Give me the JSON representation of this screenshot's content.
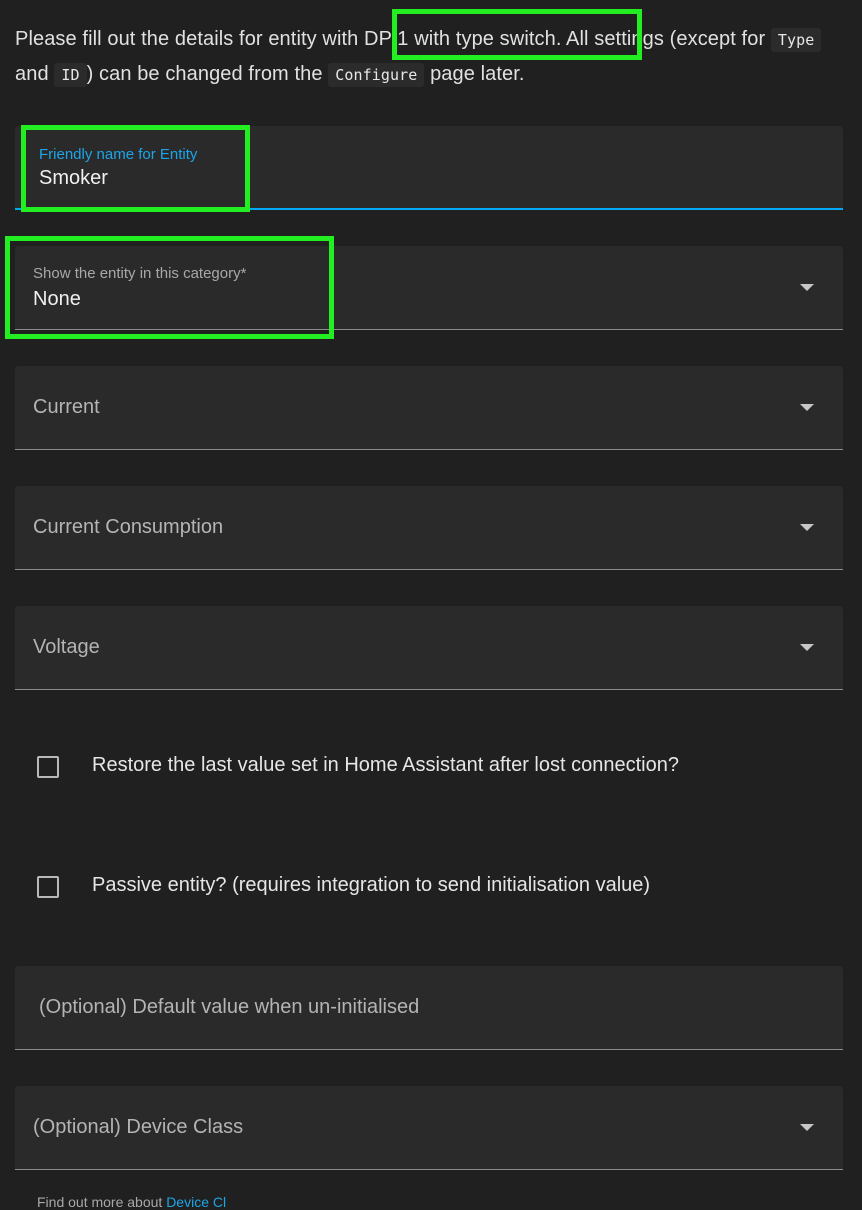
{
  "intro": {
    "part1": "Please fill out the details for entity with ",
    "dp_highlight": "DP 1 with type switch.",
    "part2": " All settings (except for ",
    "code_type": "Type",
    "part3": " and ",
    "code_id": "ID",
    "part4": ") can be changed from the ",
    "code_configure": "Configure",
    "part5": " page later."
  },
  "fields": {
    "friendly_name": {
      "label": "Friendly name for Entity",
      "value": "Smoker"
    },
    "category": {
      "label": "Show the entity in this category*",
      "value": "None"
    },
    "current": {
      "placeholder": "Current"
    },
    "current_consumption": {
      "placeholder": "Current Consumption"
    },
    "voltage": {
      "placeholder": "Voltage"
    },
    "default_value": {
      "placeholder": "(Optional) Default value when un-initialised"
    },
    "device_class": {
      "placeholder": "(Optional) Device Class"
    }
  },
  "checkboxes": {
    "restore_last_value": {
      "label": "Restore the last value set in Home Assistant after lost connection?",
      "checked": false
    },
    "passive_entity": {
      "label": "Passive entity? (requires integration to send initialisation value)",
      "checked": false
    }
  },
  "footer": {
    "text": "Find out more about ",
    "link": "Device Cl"
  },
  "colors": {
    "background": "#202020",
    "field_background": "#2a2a2a",
    "accent": "#03a9f4",
    "highlight": "#22ee22"
  }
}
